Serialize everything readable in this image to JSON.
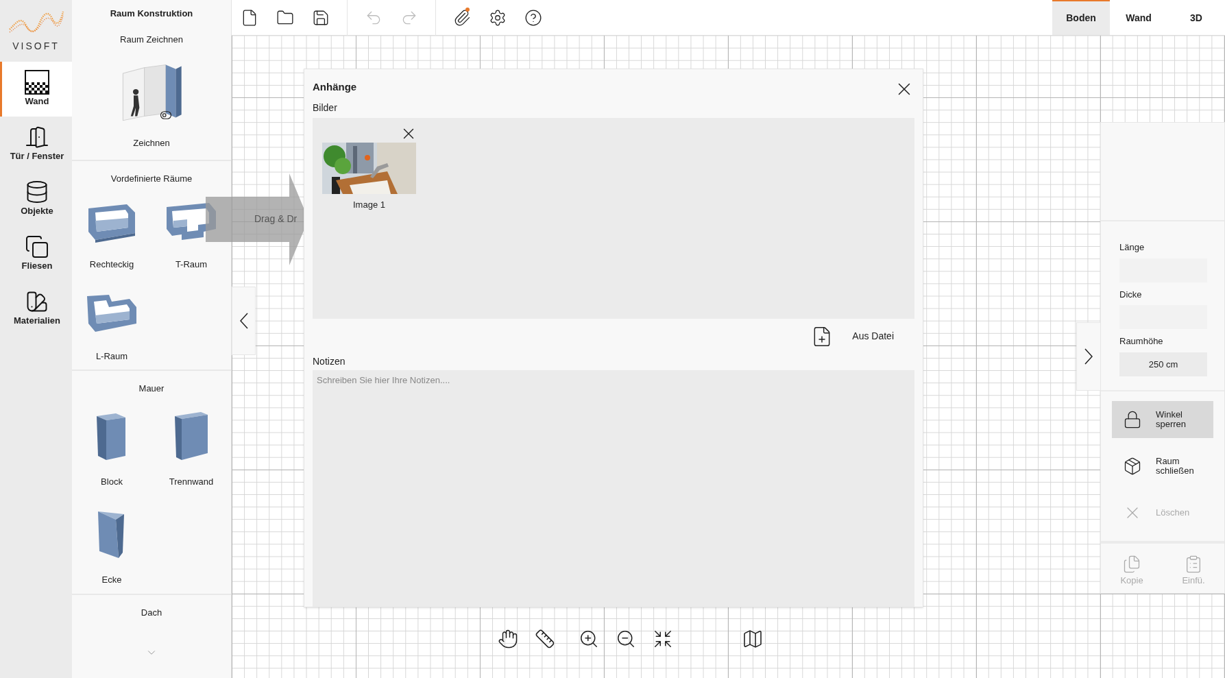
{
  "logo": {
    "text": "VISOFT"
  },
  "nav": [
    {
      "label": "Wand",
      "selected": true
    },
    {
      "label": "Tür / Fenster",
      "selected": false
    },
    {
      "label": "Objekte",
      "selected": false
    },
    {
      "label": "Fliesen",
      "selected": false
    },
    {
      "label": "Materialien",
      "selected": false
    }
  ],
  "panel": {
    "title": "Raum Konstruktion",
    "sections": [
      {
        "title": "Raum Zeichnen",
        "items": [
          {
            "label": "Zeichnen",
            "kind": "draw"
          }
        ]
      },
      {
        "title": "Vordefinierte Räume",
        "items": [
          {
            "label": "Rechteckig",
            "kind": "rect"
          },
          {
            "label": "T-Raum",
            "kind": "t"
          },
          {
            "label": "L-Raum",
            "kind": "l"
          }
        ]
      },
      {
        "title": "Mauer",
        "items": [
          {
            "label": "Block",
            "kind": "block"
          },
          {
            "label": "Trennwand",
            "kind": "wall"
          },
          {
            "label": "Ecke",
            "kind": "corner"
          }
        ]
      },
      {
        "title": "Dach"
      }
    ]
  },
  "toolbar": [
    {
      "kind": "new",
      "disabled": false,
      "dot": false
    },
    {
      "kind": "open",
      "disabled": false,
      "dot": false
    },
    {
      "kind": "save",
      "disabled": false,
      "dot": false
    },
    {
      "kind": "undo",
      "disabled": true,
      "dot": false
    },
    {
      "kind": "redo",
      "disabled": true,
      "dot": false
    },
    {
      "kind": "attach",
      "disabled": false,
      "dot": true
    },
    {
      "kind": "settings",
      "disabled": false,
      "dot": false
    },
    {
      "kind": "help",
      "disabled": false,
      "dot": false
    }
  ],
  "view_tabs": [
    {
      "label": "Boden",
      "selected": true
    },
    {
      "label": "Wand",
      "selected": false
    },
    {
      "label": "3D",
      "selected": false
    }
  ],
  "drag_hint": "Drag & Dr",
  "dialog": {
    "title": "Anhänge",
    "images_label": "Bilder",
    "images": [
      {
        "caption": "Image 1",
        "kind": "picture"
      }
    ],
    "add_button": "Aus Datei",
    "notes_label": "Notizen",
    "notes_placeholder": "Schreiben Sie hier Ihre Notizen...."
  },
  "properties": {
    "fields": [
      {
        "label": "Länge"
      },
      {
        "label": "Dicke"
      },
      {
        "label": "Raumhöhe",
        "value": "250 cm"
      }
    ],
    "actions": [
      {
        "kind": "lock",
        "label": "Winkel sperren",
        "selected": true,
        "disabled": false
      },
      {
        "kind": "close-room",
        "label": "Raum schließen",
        "selected": false,
        "disabled": false
      },
      {
        "kind": "delete",
        "label": "Löschen",
        "selected": false,
        "disabled": true
      }
    ],
    "clipboard": [
      {
        "kind": "copy",
        "label": "Kopie",
        "disabled": true
      },
      {
        "kind": "paste",
        "label": "Einfü.",
        "disabled": true
      }
    ]
  }
}
